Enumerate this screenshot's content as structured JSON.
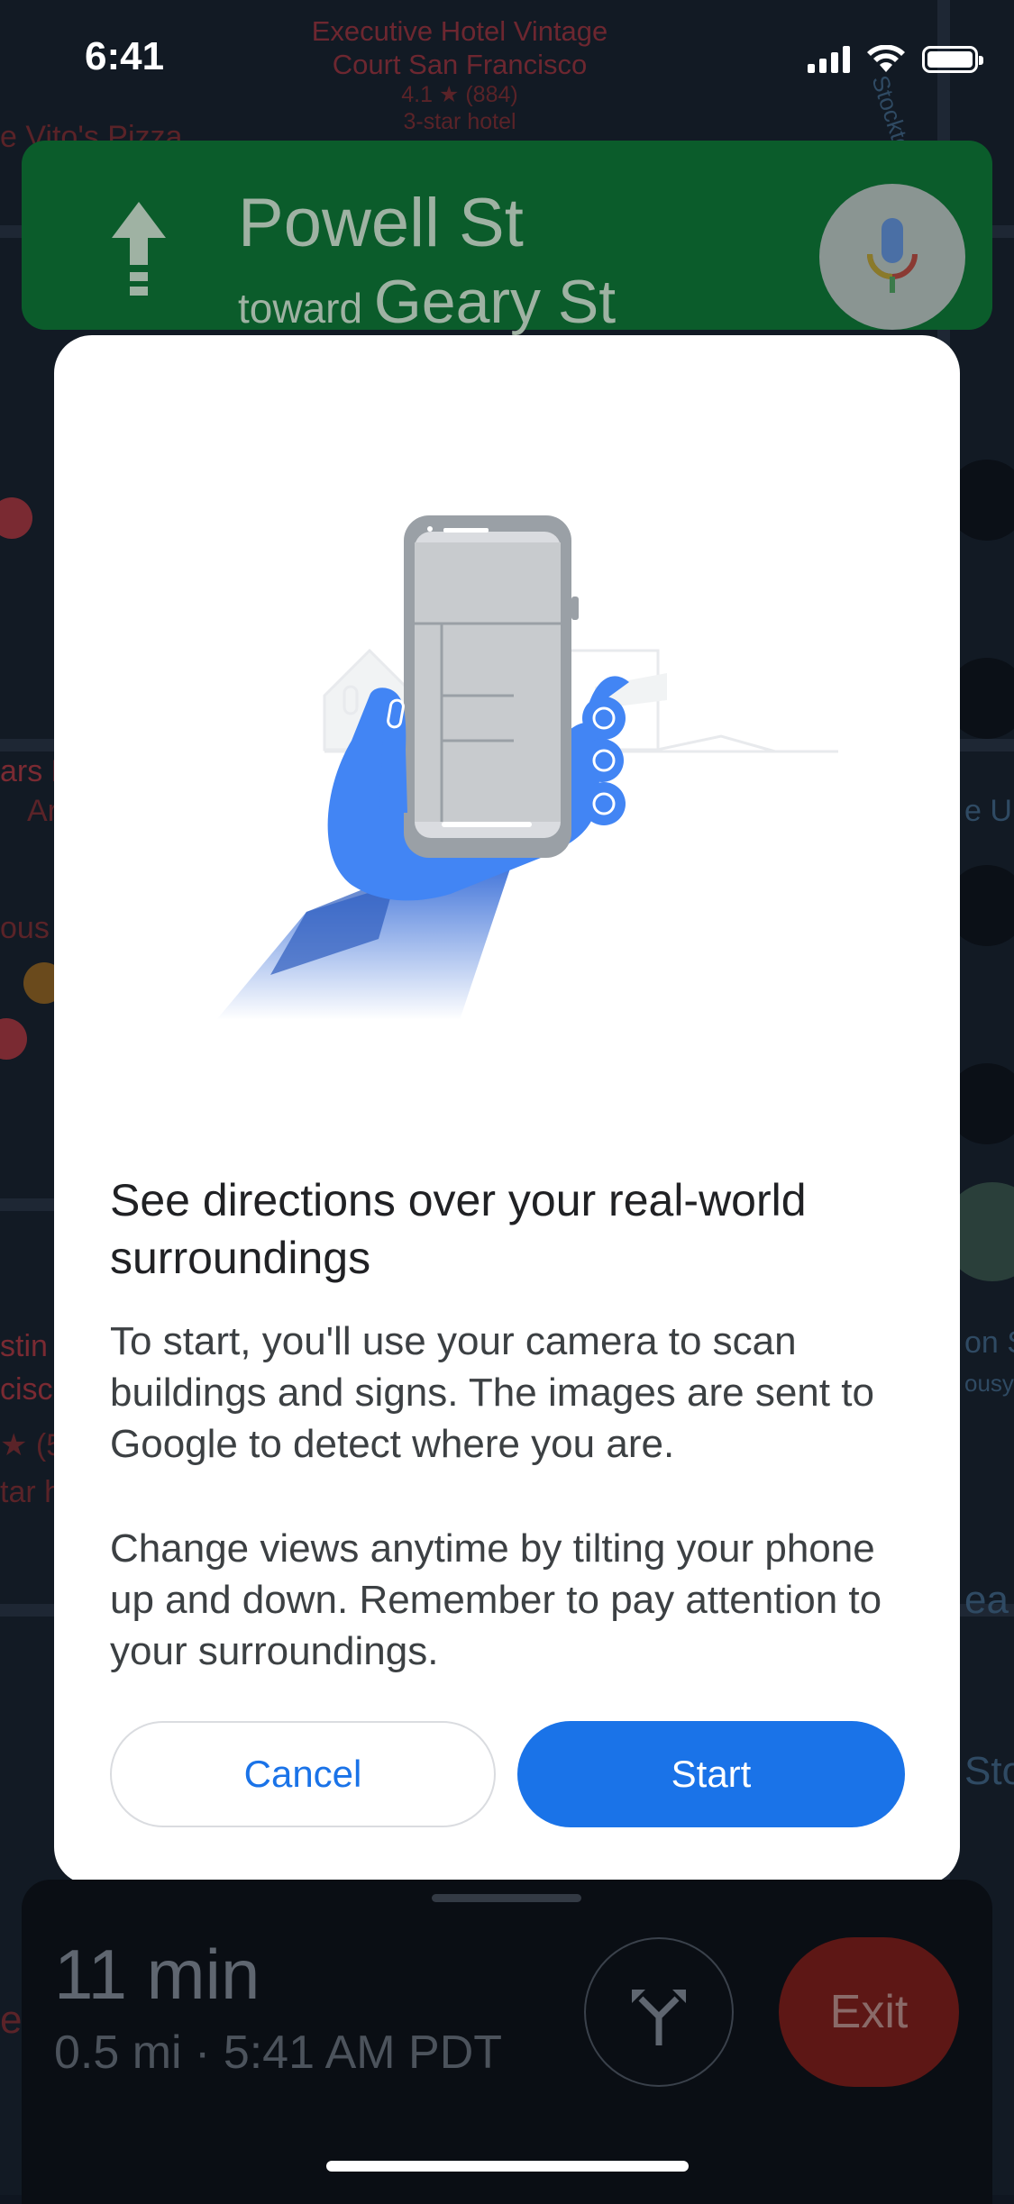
{
  "status_bar": {
    "time": "6:41"
  },
  "map": {
    "poi_label_lines": [
      "Executive Hotel Vintage",
      "Court San Francisco"
    ],
    "poi_rating": "4.1 ★ (884)",
    "poi_class": "3-star hotel",
    "left_labels": [
      "e Vito's Pizza",
      "ars F",
      "Ar",
      "ous",
      "stin",
      "cisc",
      "★ (5",
      "tar h",
      "e"
    ],
    "right_labels": [
      "Stockton St",
      "e Ur",
      "on S",
      "ousy",
      "ea",
      "Sto"
    ]
  },
  "nav_banner": {
    "street": "Powell St",
    "toward_prefix": "toward",
    "toward_street": "Geary St",
    "direction_icon": "arrow-up-icon",
    "mic_icon": "microphone-icon"
  },
  "modal": {
    "title": "See directions over your real-world surroundings",
    "body1": "To start, you'll use your camera to scan buildings and signs. The images are sent to Google to detect where you are.",
    "body2": "Change views anytime by tilting your phone up and down. Remember to pay attention to your surroundings.",
    "cancel_label": "Cancel",
    "start_label": "Start",
    "accent_color": "#1a73e8"
  },
  "bottom_sheet": {
    "eta": "11 min",
    "details": "0.5 mi · 5:41 AM PDT",
    "route_icon": "alternate-routes-icon",
    "exit_label": "Exit"
  }
}
